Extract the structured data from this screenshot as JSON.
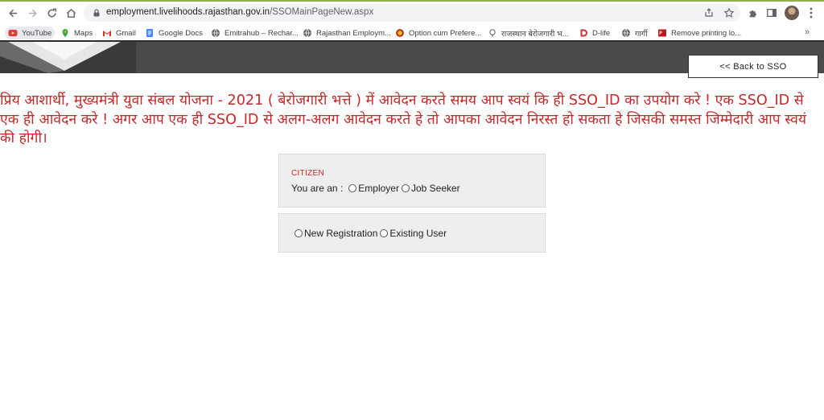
{
  "browser": {
    "url_host": "employment.livelihoods.rajasthan.gov.in",
    "url_path": "/SSOMainPageNew.aspx",
    "bookmarks": [
      {
        "label": "YouTube",
        "icon": "youtube-icon"
      },
      {
        "label": "Maps",
        "icon": "maps-icon"
      },
      {
        "label": "Gmail",
        "icon": "gmail-icon"
      },
      {
        "label": "Google Docs",
        "icon": "docs-icon"
      },
      {
        "label": "Emitrahub – Rechar...",
        "icon": "globe-icon"
      },
      {
        "label": "Rajasthan Employm...",
        "icon": "globe-icon"
      },
      {
        "label": "Option cum Prefere...",
        "icon": "emblem-icon"
      },
      {
        "label": "राजस्थान बेरोजगारी भ...",
        "icon": "bulb-icon"
      },
      {
        "label": "D-life",
        "icon": "dlife-icon"
      },
      {
        "label": "गार्गी",
        "icon": "globe-icon"
      },
      {
        "label": "Remove printing lo...",
        "icon": "pdf-icon"
      }
    ],
    "more_label": "»"
  },
  "header": {
    "back_label": "<< Back to SSO"
  },
  "notice": {
    "text": "प्रिय आशार्थी, मुख्यमंत्री युवा संबल योजना - 2021 ( बेरोजगारी भत्ते ) में आवेदन करते समय आप स्वयं कि ही SSO_ID का उपयोग करे ! एक SSO_ID से एक ही आवेदन करे ! अगर आप एक ही SSO_ID से अलग-अलग आवेदन करते हे तो आपका आवेदन निरस्त हो सकता हे जिसकी समस्त जिम्मेदारी आप स्वयं की होगी।"
  },
  "form": {
    "citizen_label": "CITIZEN",
    "you_are_label": "You are an :",
    "options_type": [
      "Employer",
      "Job Seeker"
    ],
    "options_reg": [
      "New Registration",
      "Existing User"
    ]
  },
  "colors": {
    "notice_red": "#c62828",
    "panel_bg": "#eeeeee",
    "band": "#4a4a4a"
  }
}
